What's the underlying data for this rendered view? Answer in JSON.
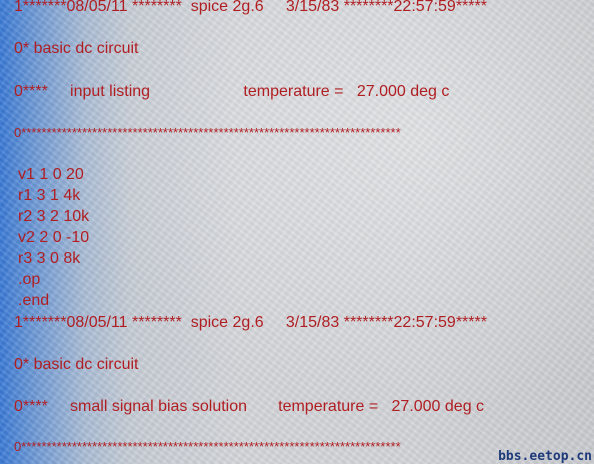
{
  "header1": {
    "text": "1*******08/05/11 ********  spice 2g.6     3/15/83 ********22:57:59*****"
  },
  "title1": {
    "text": "0* basic dc circuit"
  },
  "section1": {
    "text": "0****     input listing                     temperature =   27.000 deg c"
  },
  "separator1": {
    "text": "0***************************************************************************"
  },
  "netlist": [
    {
      "text": "v1 1 0 20"
    },
    {
      "text": "r1 3 1 4k"
    },
    {
      "text": "r2 3 2 10k"
    },
    {
      "text": "v2 2 0 -10"
    },
    {
      "text": "r3 3 0 8k"
    },
    {
      "text": ".op"
    },
    {
      "text": ".end"
    }
  ],
  "header2": {
    "text": "1*******08/05/11 ********  spice 2g.6     3/15/83 ********22:57:59*****"
  },
  "title2": {
    "text": "0* basic dc circuit"
  },
  "section2": {
    "text": "0****     small signal bias solution       temperature =   27.000 deg c"
  },
  "separator2": {
    "text": "0***************************************************************************"
  },
  "watermark": {
    "text": "bbs.eetop.cn"
  }
}
